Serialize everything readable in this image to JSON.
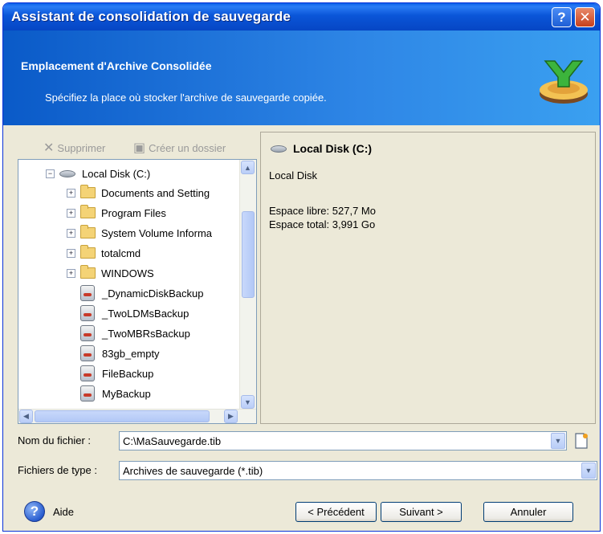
{
  "window": {
    "title": "Assistant de consolidation de sauvegarde",
    "help_btn": "?",
    "close_btn": "✕"
  },
  "banner": {
    "title": "Emplacement d'Archive Consolidée",
    "subtitle": "Spécifiez la place où stocker l'archive de sauvegarde copiée."
  },
  "toolbar": {
    "delete_label": "Supprimer",
    "new_folder_label": "Créer un dossier"
  },
  "tree": {
    "root": "Local Disk (C:)",
    "folders": [
      "Documents and Setting",
      "Program Files",
      "System Volume Informa",
      "totalcmd",
      "WINDOWS"
    ],
    "archives": [
      "_DynamicDiskBackup",
      "_TwoLDMsBackup",
      "_TwoMBRsBackup",
      "83gb_empty",
      "FileBackup",
      "MyBackup"
    ]
  },
  "info": {
    "heading": "Local Disk (C:)",
    "type": "Local Disk",
    "free": "Espace libre: 527,7 Mo",
    "total": "Espace total: 3,991 Go"
  },
  "fields": {
    "filename_label": "Nom du fichier :",
    "filename_value": "C:\\MaSauvegarde.tib",
    "filetype_label": "Fichiers de type :",
    "filetype_value": "Archives de sauvegarde (*.tib)"
  },
  "footer": {
    "help_label": "Aide",
    "back_label": "< Précédent",
    "next_label": "Suivant >",
    "cancel_label": "Annuler"
  },
  "colors": {
    "titlebar": "#0a55d8",
    "banner": "#2e86e6",
    "dialog_bg": "#ece9d8",
    "border": "#7f9db9"
  }
}
